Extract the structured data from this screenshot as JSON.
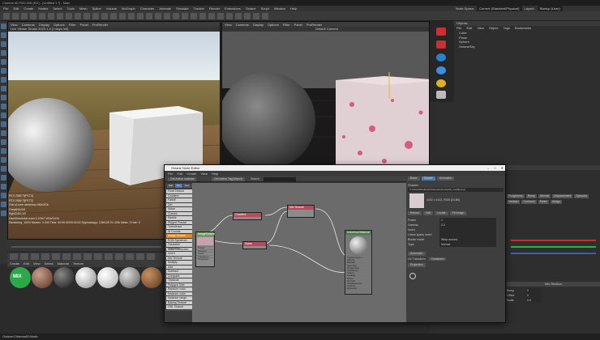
{
  "window": {
    "title": "Cinema 4D R20.026 (RC) - [Untitled 1 *] - Main",
    "menu": [
      "File",
      "Edit",
      "Create",
      "Modes",
      "Select",
      "Tools",
      "Mesh",
      "Spline",
      "Volume",
      "MoGraph",
      "Character",
      "Animate",
      "Simulate",
      "Tracker",
      "Render",
      "Extensions",
      "Octane",
      "Script",
      "Window",
      "Help"
    ],
    "node_space_label": "Node Space:",
    "node_space_value": "Current (Standard/Physical)",
    "layout_label": "Layout:",
    "layout_value": "Startup (User)"
  },
  "viewport_left": {
    "menu": [
      "View",
      "Cameras",
      "Display",
      "Options",
      "Filter",
      "Panel",
      "ProRender"
    ],
    "title": "Live Viewer Studio 2020.1.4 [1 days left]"
  },
  "viewport_right": {
    "menu": [
      "View",
      "Cameras",
      "Display",
      "Options",
      "Filter",
      "Panel",
      "ProRender"
    ],
    "title": "Default Camera"
  },
  "stats": {
    "lines": [
      "RTX 2080 Ti[P1T4]",
      "RTX 2080 Ti[P1T2]",
      "Out-of-core used/max:0Kb/4Gb",
      "Grey8/16:0/0",
      "Rgb32/64:1/0",
      "Used/free/total vram:3.1Gb/7.6Gb/11Gb",
      "Rendering: 100% Ms/sec: 0.000 Time: 00:00:02/00:00:02 Spp/maxspp: 128/128 Tri: 0/3k Mesh: 3 Hair: 0"
    ]
  },
  "objects_panel": {
    "header": "Objects",
    "menu": [
      "File",
      "Edit",
      "View",
      "Object",
      "Tags",
      "Bookmarks"
    ],
    "items": [
      "Cube",
      "Plane",
      "Sphere",
      "OctaneSky"
    ]
  },
  "node_editor": {
    "title": "Octane Node Editor",
    "menu": [
      "File",
      "Edit",
      "Create",
      "View",
      "Help"
    ],
    "toolbar": [
      "Get Active material",
      "Get Active Tag(Object)",
      "Search"
    ],
    "tabs": [
      "Mat",
      "Tex",
      "Gen",
      "Map",
      "Misc",
      "Ems",
      "Med",
      "C4D"
    ],
    "side_items": [
      "Float Texture",
      "Gradient",
      "Falloff",
      "Dirt",
      "Noise",
      "Checks",
      "Marble",
      "Ridged Fractal",
      "Turbulence",
      "W Coords",
      "Image Texture",
      "RGB Spectrum",
      "Gaussian Spectrum",
      "Color Correction",
      "Invert",
      "Mix Texture",
      "Multiply",
      "Add",
      "Subtract",
      "Compare",
      "Triplanar",
      "Polygon Side",
      "Random color",
      "Instance color",
      "Instance range",
      "Baking Texture",
      "OSL Texture",
      "Side",
      "Chaos",
      "Cinema Texture",
      "Composite Texture",
      "Noise Texture"
    ],
    "selected_side_index": 10,
    "nodes": {
      "image": {
        "title": "ImageTexture",
        "ports": [
          "Power",
          "Gamma",
          "Invert",
          "Transform",
          "Projection"
        ]
      },
      "gradient": {
        "title": "Gradient"
      },
      "mix": {
        "title": "Mix Texture"
      },
      "noise": {
        "title": "Noise"
      },
      "material": {
        "title": "Universal Material",
        "ports": [
          "Transmission",
          "Albedo",
          "Metallic",
          "Specular",
          "Roughness",
          "Anisotropy",
          "Sheen",
          "Coating",
          "Bump",
          "Normal",
          "Displacement",
          "Opacity",
          "Emission"
        ]
      }
    }
  },
  "props_panel": {
    "tabs": [
      "Basic",
      "Shader",
      "Animation"
    ],
    "section": "Shader",
    "file": "C:\\Users\\Desktop\\Octane\\textures\\pink_marble.png",
    "res": "4102 x 4102, RGB (24-Bit)",
    "buttons": [
      "Reload",
      "Edit",
      "Locate",
      "Fit image"
    ],
    "fields": [
      {
        "label": "Power",
        "value": "1."
      },
      {
        "label": "Gamma",
        "value": "2.2"
      },
      {
        "label": "Invert",
        "value": ""
      },
      {
        "label": "Linear space invert",
        "value": ""
      },
      {
        "label": "Border mode",
        "value": "Wrap around"
      },
      {
        "label": "Type",
        "value": "Normal"
      }
    ],
    "automatic": "Automatic",
    "transform_label": "UV Transform",
    "transform_value": "Transform",
    "projection": "Projection"
  },
  "attributes_panel": {
    "header": "Mat",
    "cols": [
      "Roughness",
      "Bump",
      "Normal",
      "Displacement",
      "Specular"
    ],
    "cols2": [
      "Medium",
      "Common",
      "Editor",
      "Assign"
    ],
    "mix_section": "Mix Section",
    "fields": [
      "Bump",
      "Offset",
      "Scale"
    ],
    "field_values": [
      "0",
      "0",
      "0.5"
    ]
  },
  "material_bar": {
    "menu": [
      "Create",
      "Edit",
      "View",
      "Select",
      "Material",
      "Texture"
    ],
    "materials": [
      "MIX",
      "Mat",
      "Mat",
      "Mat",
      "Mat",
      "Mat",
      "Mat"
    ]
  },
  "status": "Octane:Cinema4D:Node"
}
